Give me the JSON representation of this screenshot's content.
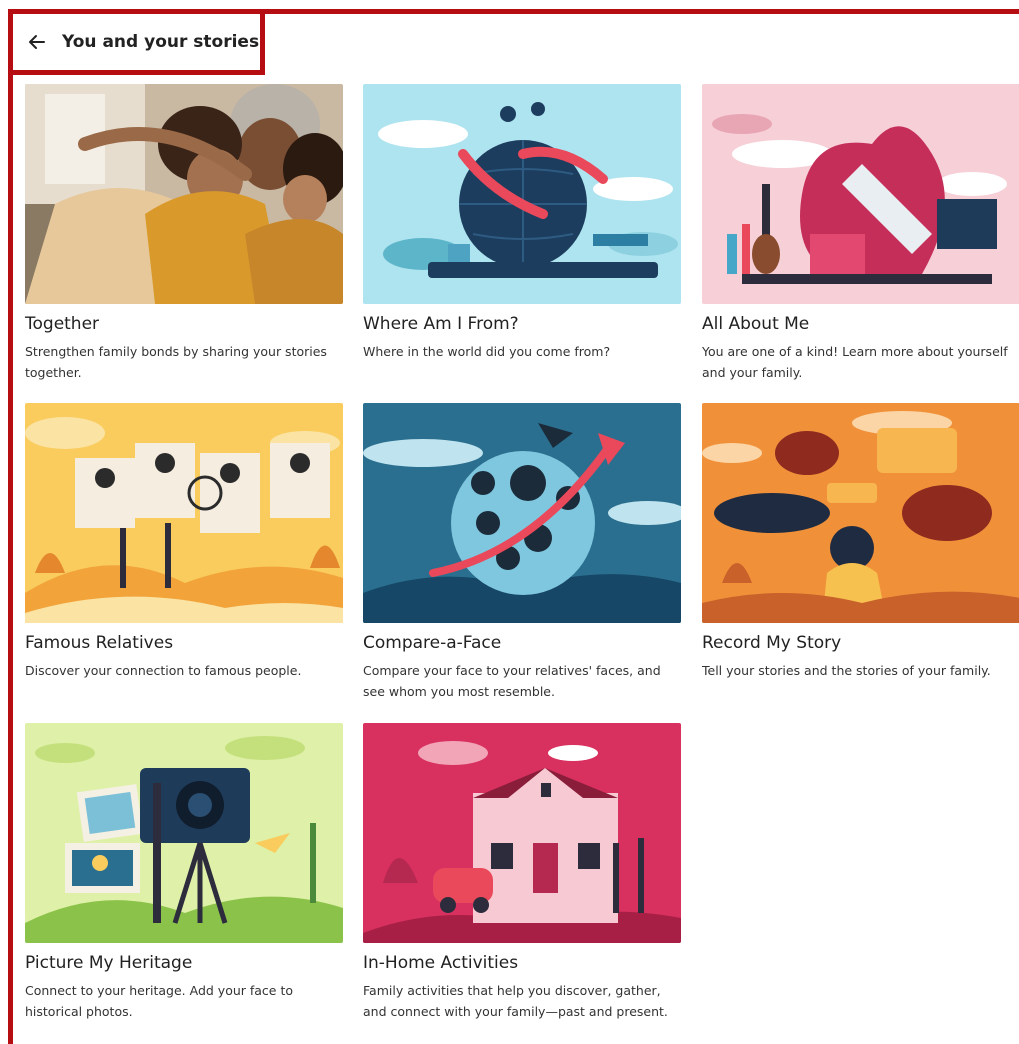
{
  "header": {
    "title": "You and your stories",
    "back_icon": "arrow-left-icon"
  },
  "colors": {
    "frame": "#b50d12"
  },
  "cards": [
    {
      "title": "Together",
      "description": "Strengthen family bonds by sharing your stories together."
    },
    {
      "title": "Where Am I From?",
      "description": "Where in the world did you come from?"
    },
    {
      "title": "All About Me",
      "description": "You are one of a kind! Learn more about yourself and your family."
    },
    {
      "title": "Famous Relatives",
      "description": "Discover your connection to famous people."
    },
    {
      "title": "Compare-a-Face",
      "description": "Compare your face to your relatives' faces, and see whom you most resemble."
    },
    {
      "title": "Record My Story",
      "description": "Tell your stories and the stories of your family."
    },
    {
      "title": "Picture My Heritage",
      "description": "Connect to your heritage. Add your face to historical photos."
    },
    {
      "title": "In-Home Activities",
      "description": "Family activities that help you discover, gather, and connect with your family—past and present."
    }
  ]
}
